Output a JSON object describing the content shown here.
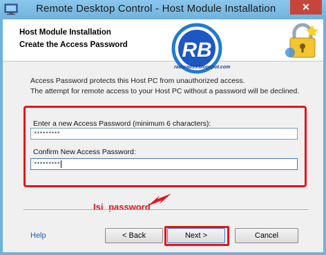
{
  "window": {
    "title": "Remote Desktop Control - Host Module Installation",
    "close_glyph": "✕"
  },
  "header": {
    "title": "Host Module Installation",
    "subtitle": "Create the Access Password",
    "logo_text": "RB",
    "blog_url": "radarad53.blogspot.com"
  },
  "body": {
    "description_line1": "Access Password protects this Host PC from unauthorized access.",
    "description_line2": "The attempt for remote access to your Host PC without a password will be declined.",
    "new_password_label": "Enter a new Access Password (minimum 6 characters):",
    "new_password_value": "*********",
    "confirm_password_label": "Confirm New Access Password:",
    "confirm_password_value": "*********"
  },
  "annotation": {
    "text": "Isi  password",
    "color": "#e0161a"
  },
  "footer": {
    "help_label": "Help",
    "back_label": "< Back",
    "next_label": "Next >",
    "cancel_label": "Cancel"
  },
  "icons": {
    "app": "remote-desktop-icon",
    "header_right": "padlock-icon",
    "logo": "rb-logo"
  },
  "colors": {
    "titlebar": "#6fb2dd",
    "close_button": "#c7463c",
    "highlight": "#e0161a",
    "link": "#1a5fb4"
  }
}
